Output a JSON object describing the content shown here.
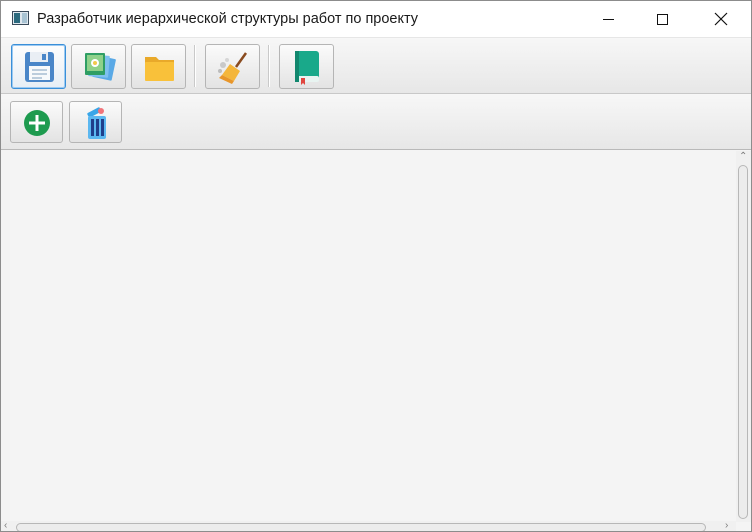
{
  "window": {
    "title": "Разработчик иерархической структуры работ по проекту"
  },
  "toolbar_main": {
    "buttons": [
      {
        "icon": "floppy-disk-icon",
        "selected": true
      },
      {
        "icon": "image-stack-icon",
        "selected": false
      },
      {
        "icon": "folder-icon",
        "selected": false
      },
      {
        "icon": "broom-icon",
        "selected": false
      },
      {
        "icon": "book-icon",
        "selected": false
      }
    ]
  },
  "toolbar_edit": {
    "buttons": [
      {
        "icon": "add-circle-icon"
      },
      {
        "icon": "trash-can-icon"
      }
    ]
  },
  "colors": {
    "accent": "#3a8fd8",
    "add": "#1e9b4f",
    "folder": "#f9c13a",
    "book": "#19a98a"
  }
}
